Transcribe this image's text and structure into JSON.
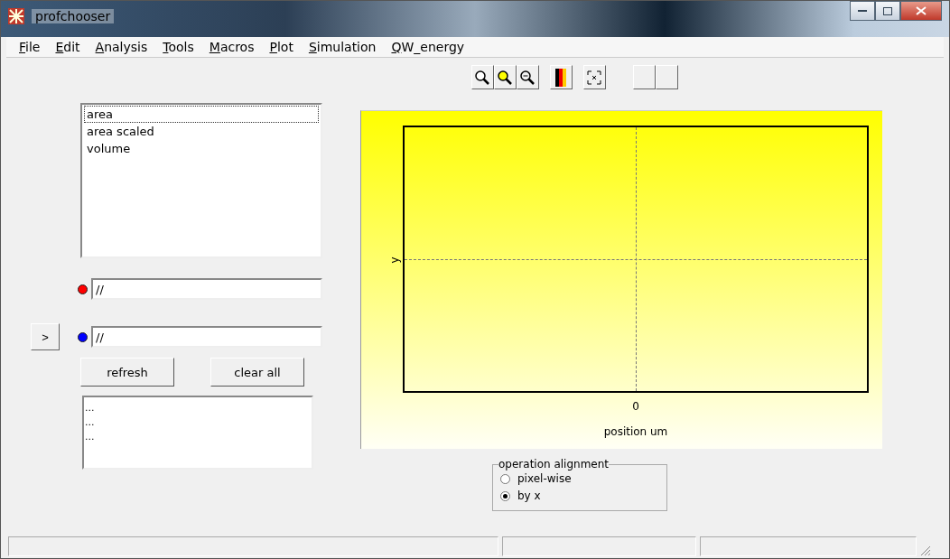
{
  "window": {
    "title": "profchooser"
  },
  "menu": [
    "File",
    "Edit",
    "Analysis",
    "Tools",
    "Macros",
    "Plot",
    "Simulation",
    "QW_energy"
  ],
  "quantity_list": [
    {
      "label": "area",
      "selected": true
    },
    {
      "label": "area scaled",
      "selected": false
    },
    {
      "label": "volume",
      "selected": false
    }
  ],
  "profiles": [
    {
      "value": "//",
      "color": "#ff0000",
      "has_arrow": false
    },
    {
      "value": "//",
      "color": "#0000ff",
      "has_arrow": true
    }
  ],
  "arrow_button": ">",
  "buttons": [
    "refresh",
    "clear all"
  ],
  "output_lines": [
    "...",
    "...",
    "..."
  ],
  "plot": {
    "ylabel": "y",
    "xtick": "0",
    "xlabel": "position um"
  },
  "alignment": {
    "title": "operation alignment",
    "options": [
      {
        "label": "pixel-wise",
        "checked": false
      },
      {
        "label": "by x",
        "checked": true
      }
    ]
  }
}
